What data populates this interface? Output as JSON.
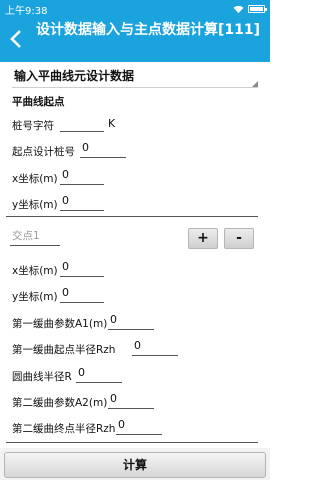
{
  "status_bar": {
    "time": "上午9:38"
  },
  "header": {
    "title": "设计数据输入与主点数据计算[111]"
  },
  "section_select": {
    "value": "输入平曲线元设计数据"
  },
  "start_point": {
    "heading": "平曲线起点",
    "station_char_label": "桩号字符",
    "station_char_value": "",
    "station_char_suffix": "K",
    "start_station_label": "起点设计桩号",
    "start_station_value": "0",
    "x_label": "x坐标(m)",
    "x_value": "0",
    "y_label": "y坐标(m)",
    "y_value": "0"
  },
  "intersection": {
    "combo_value": "交点1",
    "add_label": "+",
    "remove_label": "-",
    "x_label": "x坐标(m)",
    "x_value": "0",
    "y_label": "y坐标(m)",
    "y_value": "0",
    "a1_label": "第一缓曲参数A1(m)",
    "a1_value": "0",
    "rzh1_label": "第一缓曲起点半径Rzh",
    "rzh1_value": "0",
    "r_label": "圆曲线半径R",
    "r_value": "0",
    "a2_label": "第二缓曲参数A2(m)",
    "a2_value": "0",
    "rzh2_label": "第二缓曲终点半径Rzh",
    "rzh2_value": "0"
  },
  "footer": {
    "calc_label": "计算"
  }
}
